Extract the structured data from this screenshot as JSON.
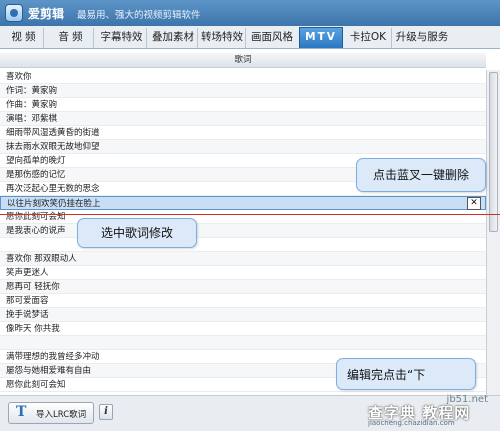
{
  "app": {
    "title": "爱剪辑",
    "slogan": "最易用、强大的视频剪辑软件"
  },
  "tabs": [
    {
      "label": "视 频"
    },
    {
      "label": "音 频"
    },
    {
      "label": "字幕特效"
    },
    {
      "label": "叠加素材"
    },
    {
      "label": "转场特效"
    },
    {
      "label": "画面风格"
    },
    {
      "label": "MTV"
    },
    {
      "label": "卡拉OK"
    },
    {
      "label": "升级与服务"
    }
  ],
  "active_tab": "MTV",
  "lyrics_header": "歌词",
  "lyrics": [
    "喜欢你",
    "作词：黄家驹",
    "作曲：黄家驹",
    "演唱：邓紫棋",
    "细雨带风湿透黄昏的街道",
    "抹去雨水双眼无故地仰望",
    "望向孤单的晚灯",
    "是那伤感的记忆",
    "再次泛起心里无数的思念",
    "以往片刻欢笑仍挂在脸上",
    "愿你此刻可会知",
    "是我衷心的说声",
    "",
    "喜欢你 那双眼动人",
    "笑声更迷人",
    "愿再可 轻抚你",
    "那可爱面容",
    "挽手说梦话",
    "像昨天 你共我",
    "",
    "满带理想的我曾经多冲动",
    "屡怨与她相爱难有自由",
    "愿你此刻可会知"
  ],
  "selected_index": 9,
  "delete_icon": "close-icon",
  "callouts": {
    "delete_tip": "点击蓝叉一键删除",
    "select_tip": "选中歌词修改",
    "done_tip": "编辑完点击“下"
  },
  "footer": {
    "import_icon_glyph": "T",
    "import_label": "导入LRC歌词",
    "info_glyph": "i"
  },
  "watermark": {
    "url": "jb51.net",
    "big": "查字典 教程网",
    "small": "jiaocheng.chazidian.com"
  },
  "colors": {
    "title_bar": "#3d74ab",
    "active_tab": "#2a78c3",
    "selected_row": "#c8def5",
    "callout_bg": "#dbe9f9",
    "red_line": "#d0302a"
  }
}
